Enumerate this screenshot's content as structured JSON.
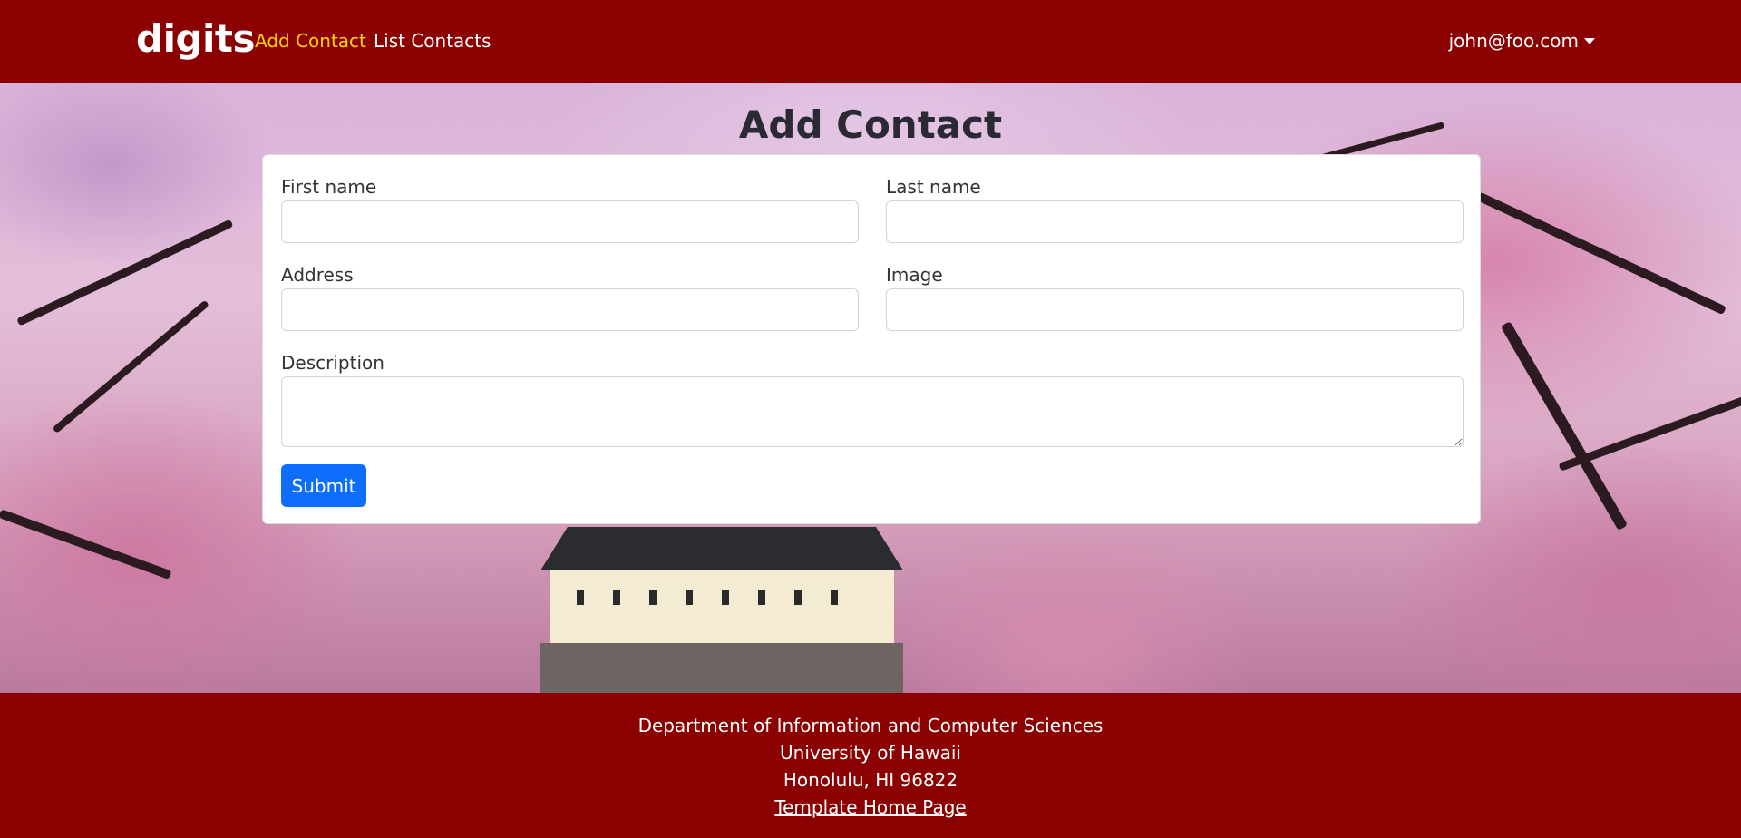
{
  "navbar": {
    "brand": "digits",
    "links": [
      {
        "label": "Add Contact",
        "active": true
      },
      {
        "label": "List Contacts",
        "active": false
      }
    ],
    "user": "john@foo.com",
    "background": "#8b0000",
    "active_color": "#ffd700"
  },
  "page": {
    "title": "Add Contact"
  },
  "form": {
    "first_name_label": "First name",
    "first_name_value": "",
    "last_name_label": "Last name",
    "last_name_value": "",
    "address_label": "Address",
    "address_value": "",
    "image_label": "Image",
    "image_value": "",
    "description_label": "Description",
    "description_value": "",
    "submit_label": "Submit",
    "submit_color": "#0d6efd"
  },
  "footer": {
    "line1": "Department of Information and Computer Sciences",
    "line2": "University of Hawaii",
    "line3": "Honolulu, HI 96822",
    "link": "Template Home Page"
  }
}
